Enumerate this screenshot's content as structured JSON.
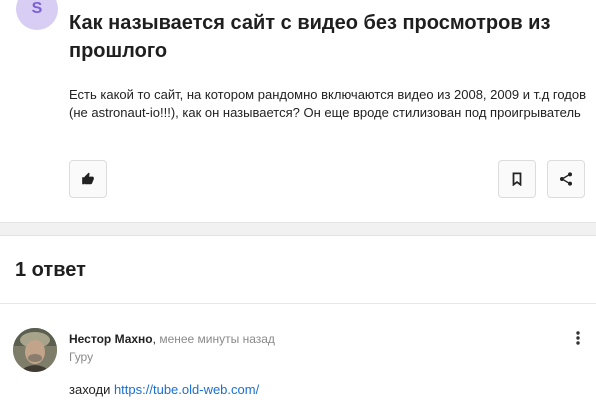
{
  "question": {
    "avatar_letter": "S",
    "title": "Как называется сайт с видео без просмотров из прошлого",
    "body": "Есть какой то сайт, на котором рандомно включаются видео из 2008, 2009 и т.д годов (не astronaut-io!!!), как он называется? Он еще вроде стилизован под проигрыватель"
  },
  "actions": {
    "like_icon": "thumbs-up-icon",
    "bookmark_icon": "bookmark-icon",
    "share_icon": "share-icon"
  },
  "answers": {
    "count_label": "1 ответ",
    "items": [
      {
        "author": "Нестор Махно",
        "separator": ", ",
        "time": "менее минуты назад",
        "rank": "Гуру",
        "text_prefix": "заходи ",
        "link": "https://tube.old-web.com/"
      }
    ]
  },
  "colors": {
    "accent_link": "#1a6fd4",
    "avatar_bg": "#d8cdf3",
    "avatar_fg": "#7b5fd6"
  }
}
